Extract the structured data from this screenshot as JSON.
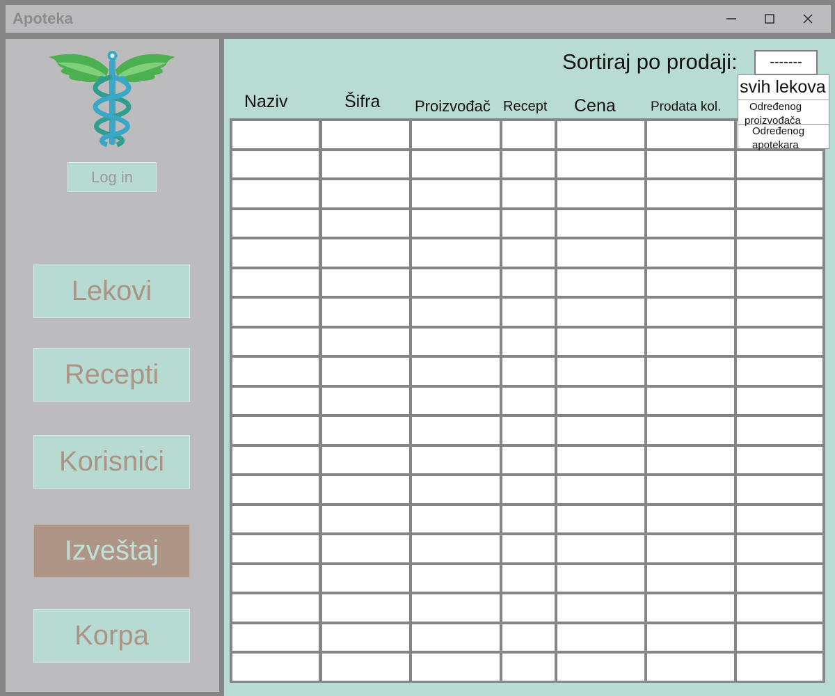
{
  "window": {
    "title": "Apoteka"
  },
  "sidebar": {
    "login_label": "Log in",
    "nav": [
      {
        "label": "Lekovi",
        "active": false
      },
      {
        "label": "Recepti",
        "active": false
      },
      {
        "label": "Korisnici",
        "active": false
      },
      {
        "label": "Izveštaj",
        "active": true
      },
      {
        "label": "Korpa",
        "active": false
      }
    ]
  },
  "report": {
    "sort_label": "Sortiraj po prodaji:",
    "sort_selected": "-------",
    "sort_options": [
      "svih lekova",
      "Određenog proizvođača",
      "Određenog apotekara"
    ],
    "option_lines": {
      "first": "svih lekova",
      "second_a": "Određenog",
      "second_b": "proizvođača",
      "third_a": "Određenog",
      "third_b": "apotekara"
    },
    "columns": [
      "Naziv",
      "Šifra",
      "Proizvođač",
      "Recept",
      "Cena",
      "Prodata kol.",
      ""
    ],
    "row_count": 19
  },
  "colors": {
    "accent": "#b8dbd3",
    "active_button": "#ae9585",
    "sidebar": "#bcbcbe",
    "frame": "#858585"
  }
}
